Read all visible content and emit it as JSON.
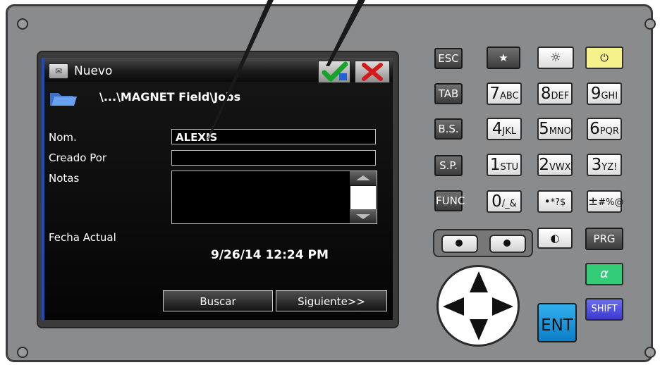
{
  "window": {
    "title": "Nuevo",
    "menu_icon": "mail-icon",
    "ok_icon": "checkmark-icon",
    "close_icon": "x-icon"
  },
  "path": {
    "text": "\\...\\MAGNET Field\\Jobs",
    "icon": "folder-icon"
  },
  "form": {
    "name_label": "Nom.",
    "name_value": "ALEXIS",
    "created_by_label": "Creado Por",
    "created_by_value": "",
    "notes_label": "Notas",
    "notes_value": "",
    "date_label": "Fecha Actual",
    "date_value": "9/26/14 12:24 PM"
  },
  "buttons": {
    "search": "Buscar",
    "next": "Siguiente>>"
  },
  "keypad": {
    "esc": "ESC",
    "star": "★",
    "sun": "☼",
    "power": "⏻",
    "tab": "TAB",
    "bs": "B.S.",
    "sp": "S.P.",
    "func": "FUNC",
    "prg": "PRG",
    "alpha": "α",
    "shift": "SHIFT",
    "ent": "ENT",
    "light": "◐",
    "keys": [
      {
        "big": "7",
        "small": "ABC"
      },
      {
        "big": "8",
        "small": "DEF"
      },
      {
        "big": "9",
        "small": "GHI"
      },
      {
        "big": "4",
        "small": "JKL"
      },
      {
        "big": "5",
        "small": "MNO"
      },
      {
        "big": "6",
        "small": "PQR"
      },
      {
        "big": "1",
        "small": "STU"
      },
      {
        "big": "2",
        "small": "VWX"
      },
      {
        "big": "3",
        "small": "YZ!"
      },
      {
        "big": "0",
        "small": "/_&"
      },
      {
        "big": "•",
        "small": "*?$"
      },
      {
        "big": "±",
        "small": "#%@"
      }
    ]
  },
  "colors": {
    "device": "#8a8b8c",
    "screen_accent": "#1b4cc3",
    "power_key": "#f6f28b",
    "alpha_key": "#33cc77",
    "shift_key": "#4a4ae0",
    "ent_key": "#1b9ae0"
  }
}
